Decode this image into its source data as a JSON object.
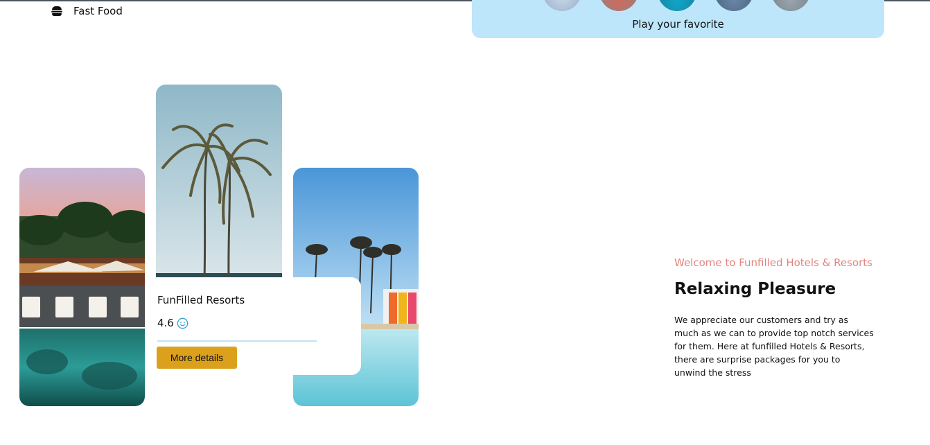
{
  "nav": {
    "fast_food_label": "Fast Food"
  },
  "play": {
    "label": "Play your favorite"
  },
  "resort_card": {
    "title": "FunFilled Resorts",
    "rating": "4.6",
    "button_label": "More details"
  },
  "about": {
    "welcome": "Welcome to Funfilled Hotels & Resorts",
    "headline": "Relaxing Pleasure",
    "body": "We appreciate our customers and try as much as we can to provide top notch services for them. Here at funfilled Hotels & Resorts, there are surprise packages for you to unwind the stress"
  },
  "colors": {
    "panel_bg": "#bde6fb",
    "button_bg": "#dca11c",
    "welcome_text": "#e5837f",
    "rating_icon": "#3aa0c8"
  },
  "icons": {
    "nav": "burger-icon",
    "rating": "smile-icon"
  }
}
